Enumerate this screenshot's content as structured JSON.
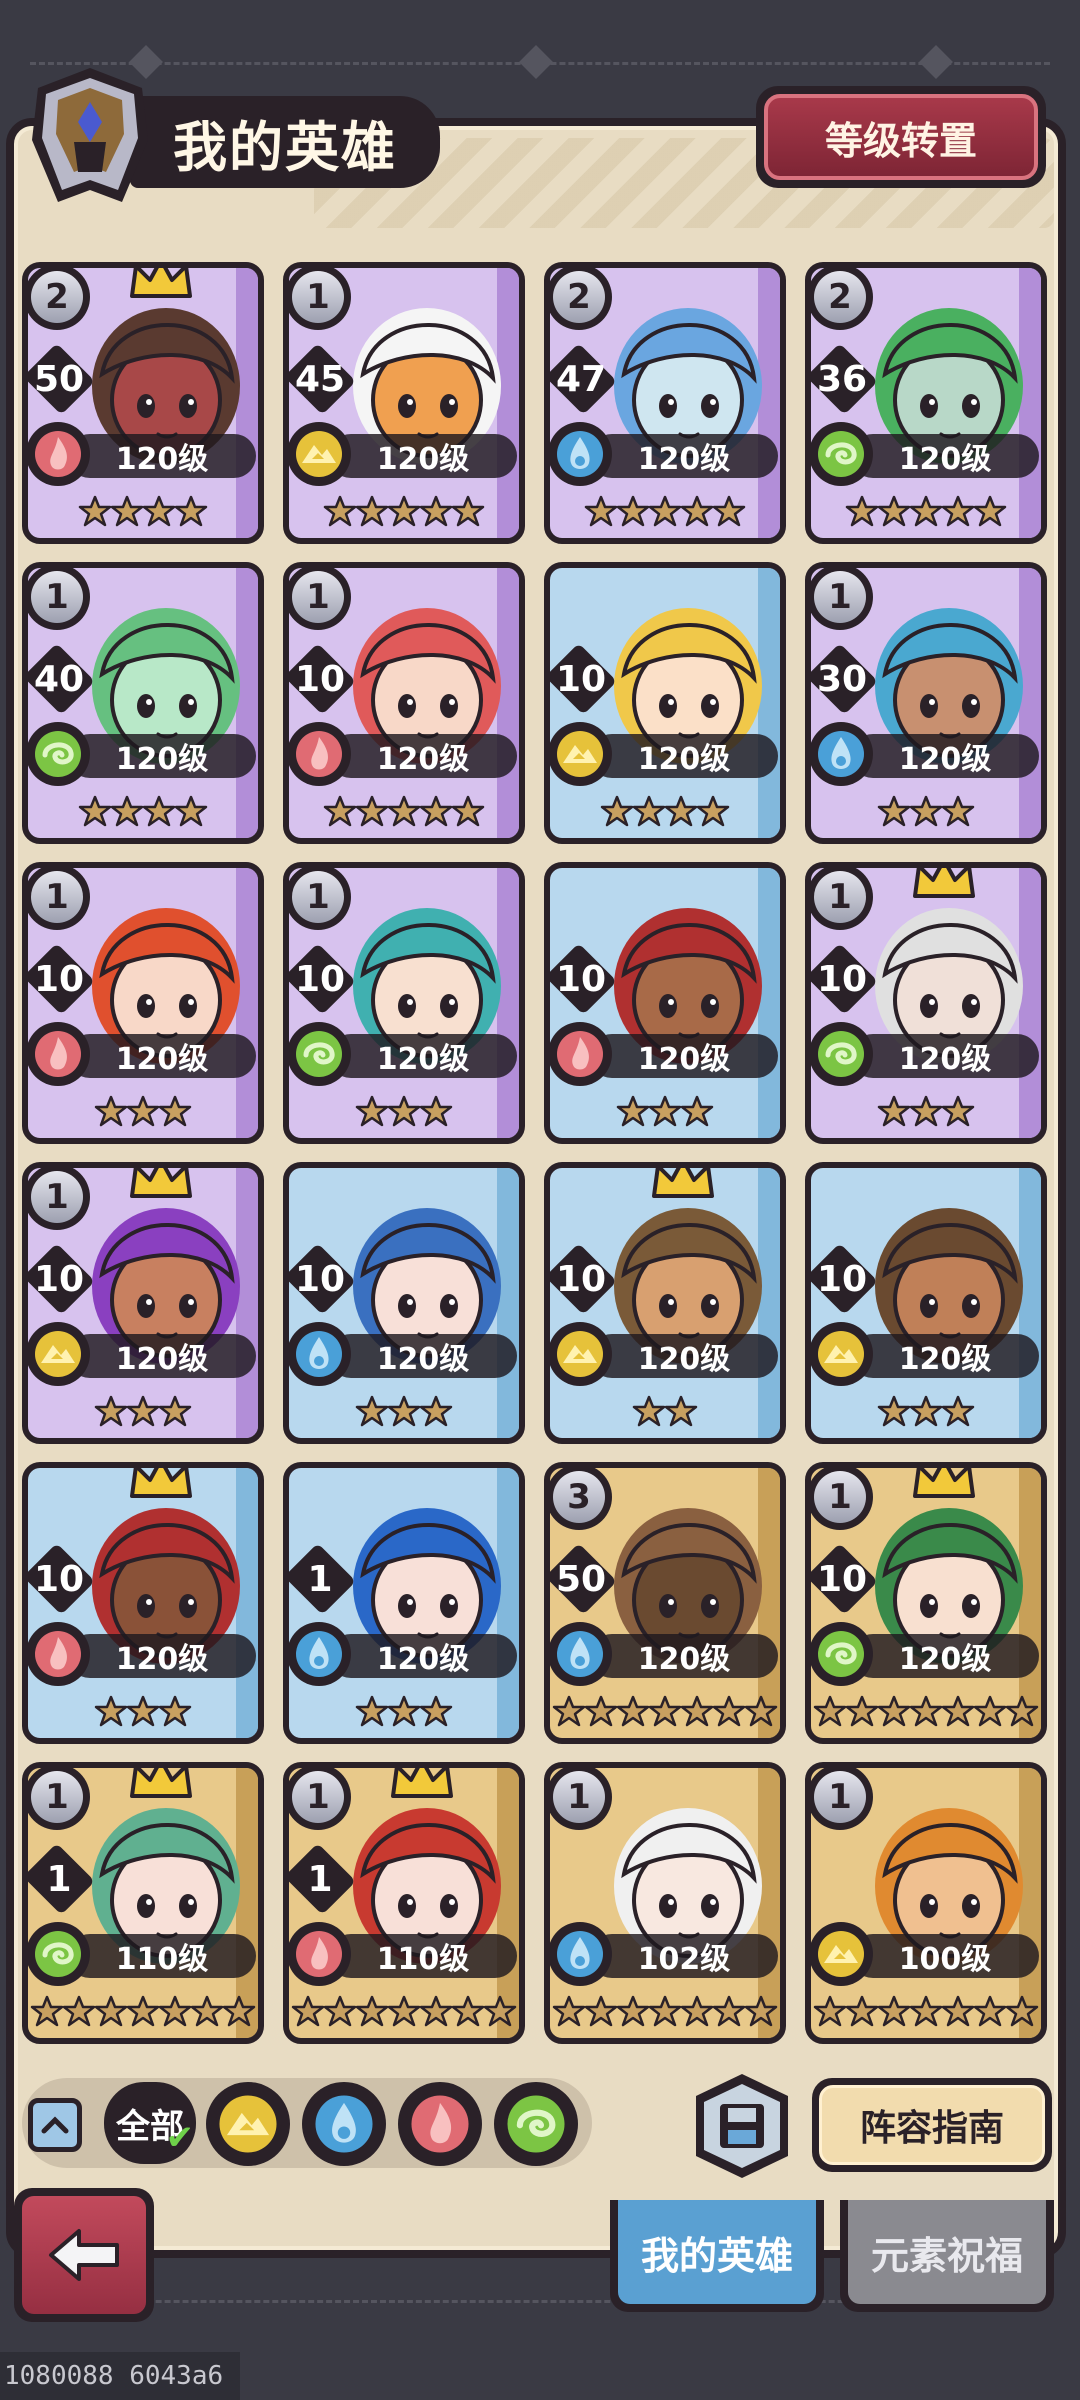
{
  "header": {
    "title": "我的英雄",
    "level_reset_label": "等级转置"
  },
  "colors": {
    "fire": "#e06b73",
    "water": "#4aa0d8",
    "earth": "#e6c23a",
    "wind": "#7cc544",
    "panel": "#e8dcc3",
    "dark": "#2a2128"
  },
  "heroes": [
    {
      "rank": "2",
      "count": "50",
      "level": "120级",
      "stars": 4,
      "element": "fire",
      "frame": "purple",
      "crown": true,
      "skin": "#a84848",
      "hair": "#5a3a30"
    },
    {
      "rank": "1",
      "count": "45",
      "level": "120级",
      "stars": 5,
      "element": "earth",
      "frame": "purple",
      "crown": false,
      "skin": "#f0a050",
      "hair": "#f5f5f5"
    },
    {
      "rank": "2",
      "count": "47",
      "level": "120级",
      "stars": 5,
      "element": "water",
      "frame": "purple",
      "crown": false,
      "skin": "#cfe6f0",
      "hair": "#6aa6e0"
    },
    {
      "rank": "2",
      "count": "36",
      "level": "120级",
      "stars": 5,
      "element": "wind",
      "frame": "purple",
      "crown": false,
      "skin": "#b8d8c8",
      "hair": "#4ab060"
    },
    {
      "rank": "1",
      "count": "40",
      "level": "120级",
      "stars": 4,
      "element": "wind",
      "frame": "purple",
      "crown": false,
      "skin": "#b8e8c8",
      "hair": "#66c080"
    },
    {
      "rank": "1",
      "count": "10",
      "level": "120级",
      "stars": 5,
      "element": "fire",
      "frame": "purple",
      "crown": false,
      "skin": "#f8d8c8",
      "hair": "#e05a5a"
    },
    {
      "rank": "",
      "count": "10",
      "level": "120级",
      "stars": 4,
      "element": "earth",
      "frame": "blue",
      "crown": false,
      "skin": "#fbe0c8",
      "hair": "#f0c84a"
    },
    {
      "rank": "1",
      "count": "30",
      "level": "120级",
      "stars": 3,
      "element": "water",
      "frame": "purple",
      "crown": false,
      "skin": "#c89070",
      "hair": "#4aa8d0"
    },
    {
      "rank": "1",
      "count": "10",
      "level": "120级",
      "stars": 3,
      "element": "fire",
      "frame": "purple",
      "crown": false,
      "skin": "#f8d8c8",
      "hair": "#e0502e"
    },
    {
      "rank": "1",
      "count": "10",
      "level": "120级",
      "stars": 3,
      "element": "wind",
      "frame": "purple",
      "crown": false,
      "skin": "#f8e0d0",
      "hair": "#40b0b0"
    },
    {
      "rank": "",
      "count": "10",
      "level": "120级",
      "stars": 3,
      "element": "fire",
      "frame": "blue",
      "crown": false,
      "skin": "#a86a48",
      "hair": "#b03030"
    },
    {
      "rank": "1",
      "count": "10",
      "level": "120级",
      "stars": 3,
      "element": "wind",
      "frame": "purple",
      "crown": true,
      "skin": "#f0e0d8",
      "hair": "#e0e0e0"
    },
    {
      "rank": "1",
      "count": "10",
      "level": "120级",
      "stars": 3,
      "element": "earth",
      "frame": "purple",
      "crown": true,
      "skin": "#c88060",
      "hair": "#8a40c0"
    },
    {
      "rank": "",
      "count": "10",
      "level": "120级",
      "stars": 3,
      "element": "water",
      "frame": "blue",
      "crown": false,
      "skin": "#f8e0d8",
      "hair": "#3a70c0"
    },
    {
      "rank": "",
      "count": "10",
      "level": "120级",
      "stars": 2,
      "element": "earth",
      "frame": "blue",
      "crown": true,
      "skin": "#d8a070",
      "hair": "#7a5a38"
    },
    {
      "rank": "",
      "count": "10",
      "level": "120级",
      "stars": 3,
      "element": "earth",
      "frame": "blue",
      "crown": false,
      "skin": "#c08058",
      "hair": "#6a4a30"
    },
    {
      "rank": "",
      "count": "10",
      "level": "120级",
      "stars": 3,
      "element": "fire",
      "frame": "blue",
      "crown": true,
      "skin": "#8a5238",
      "hair": "#b03030"
    },
    {
      "rank": "",
      "count": "1",
      "level": "120级",
      "stars": 3,
      "element": "water",
      "frame": "blue",
      "crown": false,
      "skin": "#f8e0d8",
      "hair": "#2a68c8"
    },
    {
      "rank": "3",
      "count": "50",
      "level": "120级",
      "stars": 7,
      "element": "water",
      "frame": "gold",
      "crown": false,
      "skin": "#6a4a30",
      "hair": "#8a6040"
    },
    {
      "rank": "1",
      "count": "10",
      "level": "120级",
      "stars": 7,
      "element": "wind",
      "frame": "gold",
      "crown": true,
      "skin": "#f8e0d0",
      "hair": "#3a8a4a"
    },
    {
      "rank": "1",
      "count": "1",
      "level": "110级",
      "stars": 7,
      "element": "wind",
      "frame": "gold",
      "crown": true,
      "skin": "#f8e0d8",
      "hair": "#60b090"
    },
    {
      "rank": "1",
      "count": "1",
      "level": "110级",
      "stars": 7,
      "element": "fire",
      "frame": "gold",
      "crown": true,
      "skin": "#f8e0d8",
      "hair": "#c83a30"
    },
    {
      "rank": "1",
      "count": "",
      "level": "102级",
      "stars": 7,
      "element": "water",
      "frame": "gold",
      "crown": false,
      "skin": "#f8e8e0",
      "hair": "#f0f0f0"
    },
    {
      "rank": "1",
      "count": "",
      "level": "100级",
      "stars": 7,
      "element": "earth",
      "frame": "gold",
      "crown": false,
      "skin": "#f0c090",
      "hair": "#e08a30"
    }
  ],
  "filters": {
    "all_label": "全部",
    "elements": [
      "earth",
      "water",
      "fire",
      "wind"
    ]
  },
  "actions": {
    "guide_label": "阵容指南"
  },
  "tabs": [
    {
      "label": "我的英雄",
      "active": true
    },
    {
      "label": "元素祝福",
      "active": false
    }
  ],
  "footer_code": "1080088 6043a6"
}
